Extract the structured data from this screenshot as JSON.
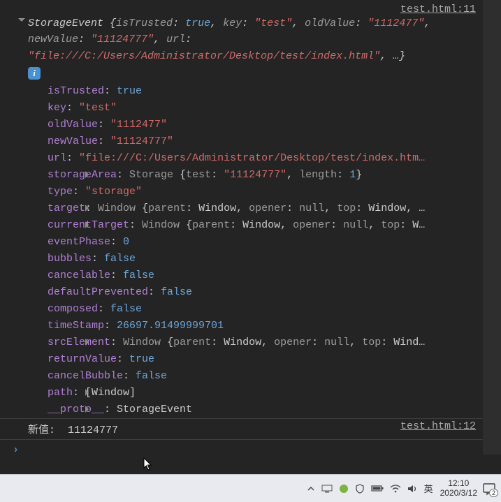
{
  "source1": "test.html:11",
  "source2": "test.html:12",
  "summary": {
    "class": "StorageEvent",
    "isTrusted": "true",
    "key": "\"test\"",
    "oldValue": "\"1112477\"",
    "newValue": "\"11124777\"",
    "urlLabel": "url",
    "url": "\"file:///C:/Users/Administrator/Desktop/test/index.html\"",
    "ellips": "…"
  },
  "info": "i",
  "props": {
    "isTrusted": {
      "v": "true",
      "c": "p-blue"
    },
    "key": {
      "v": "\"test\"",
      "c": "p-red"
    },
    "oldValue": {
      "v": "\"1112477\"",
      "c": "p-red"
    },
    "newValue": {
      "v": "\"11124777\"",
      "c": "p-red"
    },
    "url": {
      "v": "\"file:///C:/Users/Administrator/Desktop/test/index.htm…",
      "c": "p-red"
    },
    "storageArea": {
      "class": "Storage",
      "inner": [
        {
          "k": "test",
          "v": "\"11124777\"",
          "c": "p-red"
        },
        {
          "k": "length",
          "v": "1",
          "c": "p-blue"
        }
      ]
    },
    "type": {
      "v": "\"storage\"",
      "c": "p-red"
    },
    "target": {
      "class": "Window",
      "inner": [
        {
          "k": "parent",
          "v": "Window",
          "c": "p-text"
        },
        {
          "k": "opener",
          "v": "null",
          "c": "p-gray"
        },
        {
          "k": "top",
          "v": "Window",
          "c": "p-text"
        }
      ],
      "trail": ", …"
    },
    "currentTarget": {
      "class": "Window",
      "inner": [
        {
          "k": "parent",
          "v": "Window",
          "c": "p-text"
        },
        {
          "k": "opener",
          "v": "null",
          "c": "p-gray"
        },
        {
          "k": "top",
          "v": "W…",
          "c": "p-text"
        }
      ]
    },
    "eventPhase": {
      "v": "0",
      "c": "p-blue"
    },
    "bubbles": {
      "v": "false",
      "c": "p-blue"
    },
    "cancelable": {
      "v": "false",
      "c": "p-blue"
    },
    "defaultPrevented": {
      "v": "false",
      "c": "p-blue"
    },
    "composed": {
      "v": "false",
      "c": "p-blue"
    },
    "timeStamp": {
      "v": "26697.91499999701",
      "c": "p-blue"
    },
    "srcElement": {
      "class": "Window",
      "inner": [
        {
          "k": "parent",
          "v": "Window",
          "c": "p-text"
        },
        {
          "k": "opener",
          "v": "null",
          "c": "p-gray"
        },
        {
          "k": "top",
          "v": "Wind…",
          "c": "p-text"
        }
      ]
    },
    "returnValue": {
      "v": "true",
      "c": "p-blue"
    },
    "cancelBubble": {
      "v": "false",
      "c": "p-blue"
    },
    "path": {
      "raw": "[Window]"
    },
    "__proto__": {
      "raw": "StorageEvent"
    }
  },
  "log2": {
    "label": "新值:",
    "value": "11124777"
  },
  "taskbar": {
    "ime": "英",
    "time": "12:10",
    "date": "2020/3/12",
    "notifications": "2"
  }
}
